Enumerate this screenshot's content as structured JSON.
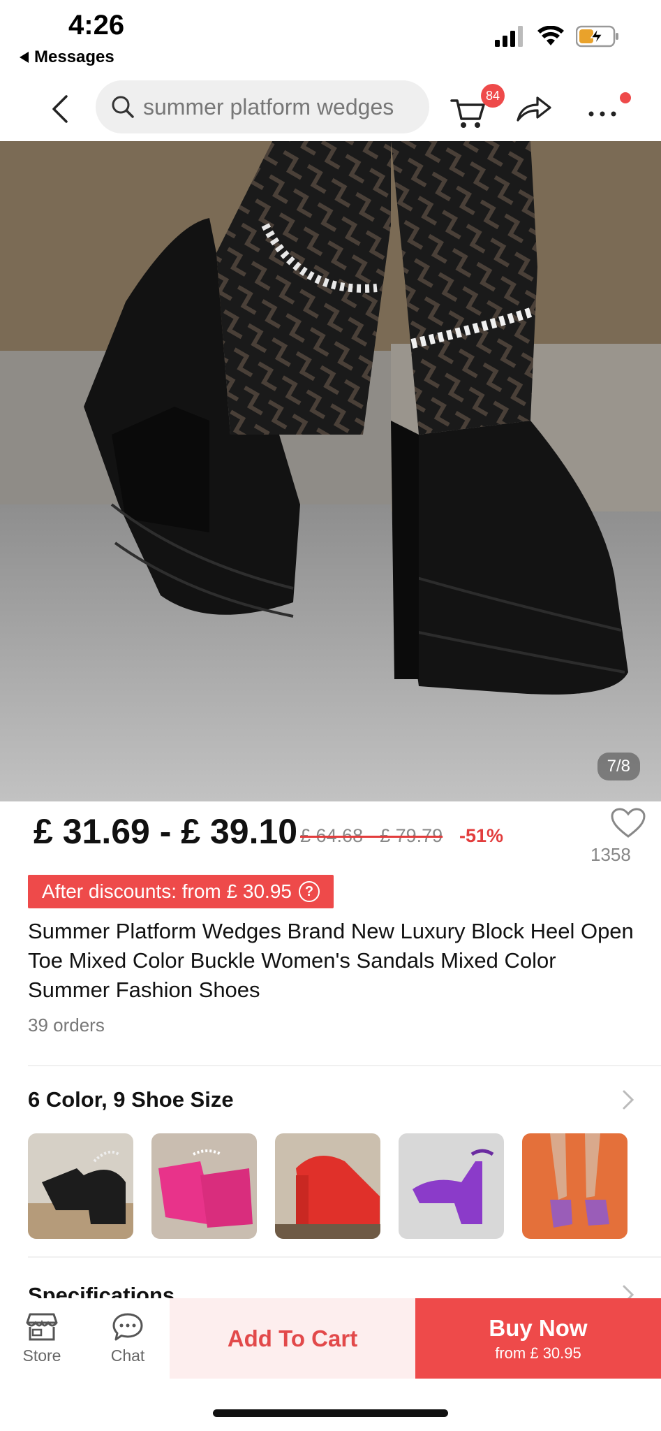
{
  "status_bar": {
    "time": "4:26",
    "back_label": "Messages",
    "icons": [
      "signal-icon",
      "wifi-icon",
      "battery-charging-icon"
    ]
  },
  "nav": {
    "search_query": "summer platform wedges",
    "cart_count": "84",
    "icons": [
      "back-arrow-icon",
      "search-icon",
      "cart-icon",
      "share-icon",
      "more-icon"
    ]
  },
  "gallery": {
    "counter": "7/8"
  },
  "product": {
    "price_range": "£ 31.69 - £ 39.10",
    "original_price": "£ 64.68 - £ 79.79",
    "discount": "-51%",
    "wishlist_count": "1358",
    "after_discount_label": "After discounts: from  £ 30.95",
    "title": "Summer Platform Wedges Brand New Luxury Block Heel Open Toe Mixed Color Buckle Women's Sandals Mixed Color Summer Fashion Shoes",
    "orders": "39 orders"
  },
  "variants": {
    "heading": "6 Color, 9 Shoe Size",
    "thumbnails": [
      {
        "color": "#1c1c1c"
      },
      {
        "color": "#e8338a"
      },
      {
        "color": "#e0302a"
      },
      {
        "color": "#8b3bc9"
      },
      {
        "color": "#9a5db8"
      }
    ]
  },
  "specs": {
    "heading": "Specifications"
  },
  "bottom_bar": {
    "store_label": "Store",
    "chat_label": "Chat",
    "add_to_cart_label": "Add To Cart",
    "buy_now_label": "Buy Now",
    "buy_now_sub": "from  £ 30.95"
  },
  "colors": {
    "accent": "#ee4a4a",
    "accent_light": "#fdeeee"
  }
}
